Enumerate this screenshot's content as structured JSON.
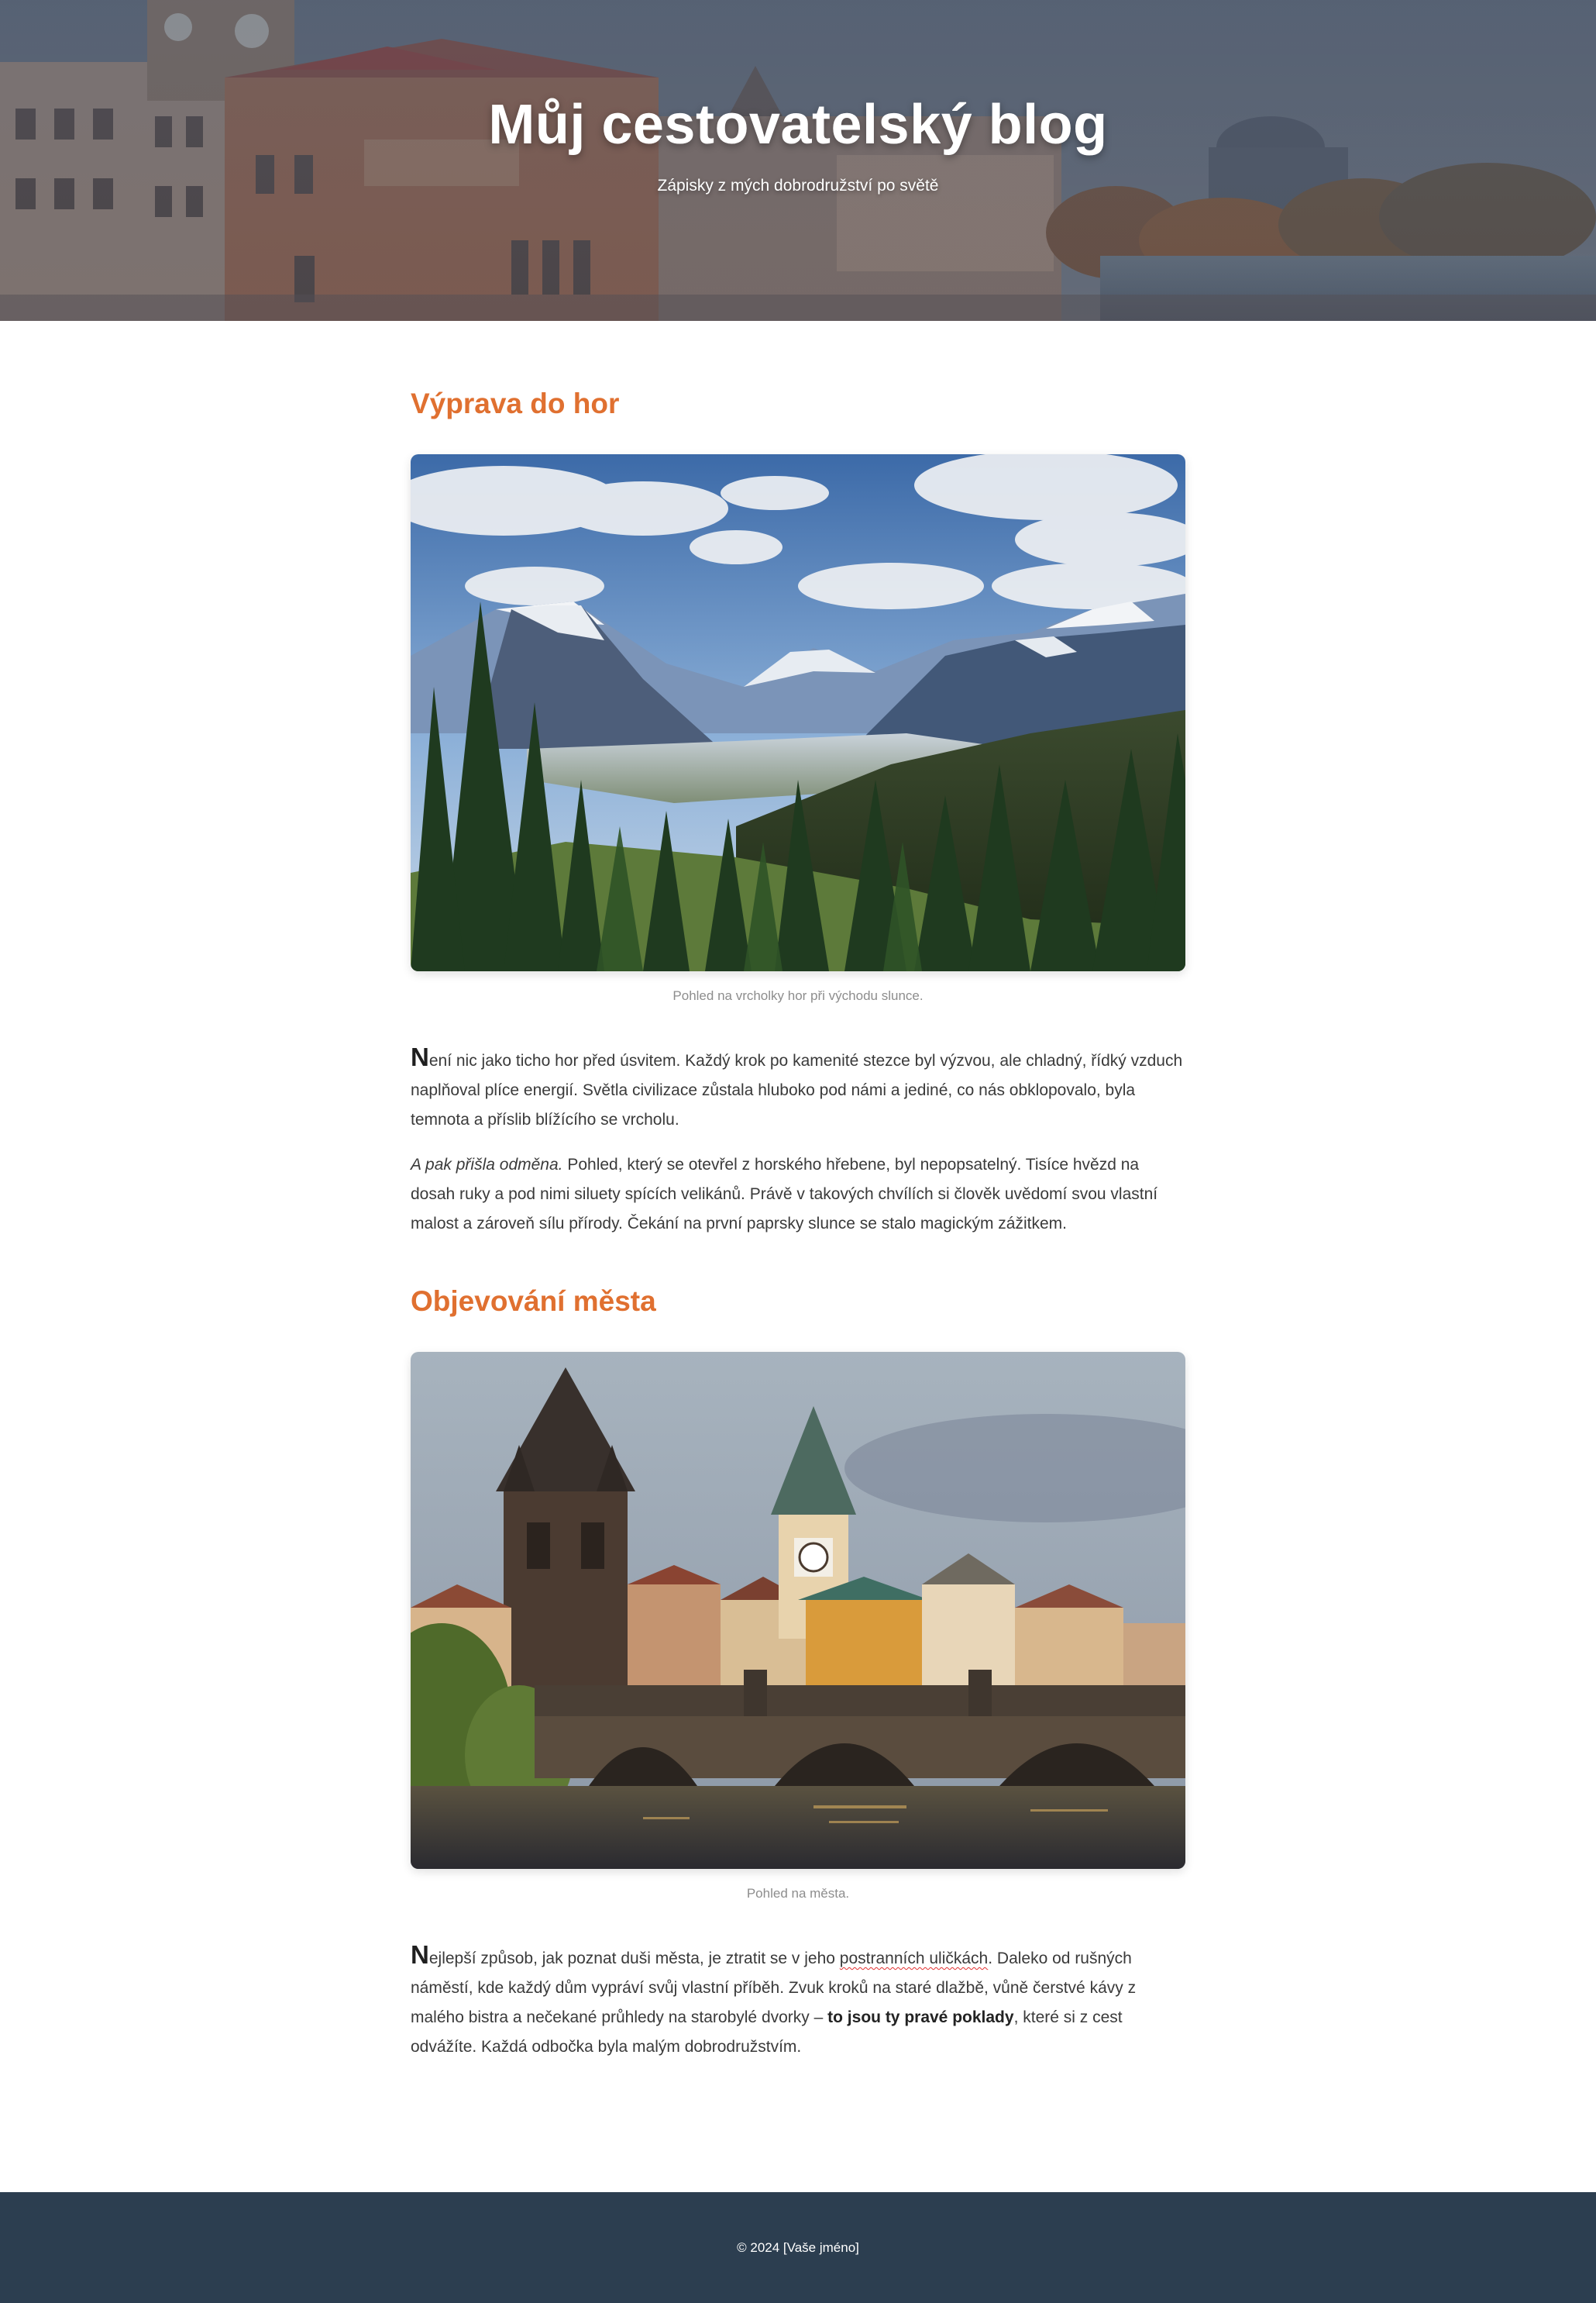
{
  "header": {
    "title": "Můj cestovatelský blog",
    "subtitle": "Zápisky z mých dobrodružství po světě"
  },
  "posts": [
    {
      "title": "Výprava do hor",
      "image_alt": "Pohled na vrcholky hor při východu slunce.",
      "caption": "Pohled na vrcholky hor při východu slunce.",
      "p1": {
        "dropcap": "N",
        "text": "ení nic jako ticho hor před úsvitem. Každý krok po kamenité stezce byl výzvou, ale chladný, řídký vzduch naplňoval plíce energií. Světla civilizace zůstala hluboko pod námi a jediné, co nás obklopovalo, byla temnota a příslib blížícího se vrcholu."
      },
      "p2": {
        "italic_lead": "A pak přišla odměna.",
        "text": " Pohled, který se otevřel z horského hřebene, byl nepopsatelný. Tisíce hvězd na dosah ruky a pod nimi siluety spících velikánů. Právě v takových chvílích si člověk uvědomí svou vlastní malost a zároveň sílu přírody. Čekání na první paprsky slunce se stalo magickým zážitkem."
      }
    },
    {
      "title": "Objevování města",
      "image_alt": "Pohled na města.",
      "caption": "Pohled na města.",
      "p1": {
        "dropcap": "N",
        "before": "ejlepší způsob, jak poznat duši města, je ztratit se v jeho ",
        "misspelled": "postranních uličkách",
        "middle": ". Daleko od rušných náměstí, kde každý dům vypráví svůj vlastní příběh. Zvuk kroků na staré dlažbě, vůně čerstvé kávy z malého bistra a nečekané průhledy na starobylé dvorky – ",
        "bold": "to jsou ty pravé poklady",
        "after": ", které si z cest odvážíte. Každá odbočka byla malým dobrodružstvím."
      }
    }
  ],
  "footer": {
    "text": "© 2024 [Vaše jméno]"
  }
}
